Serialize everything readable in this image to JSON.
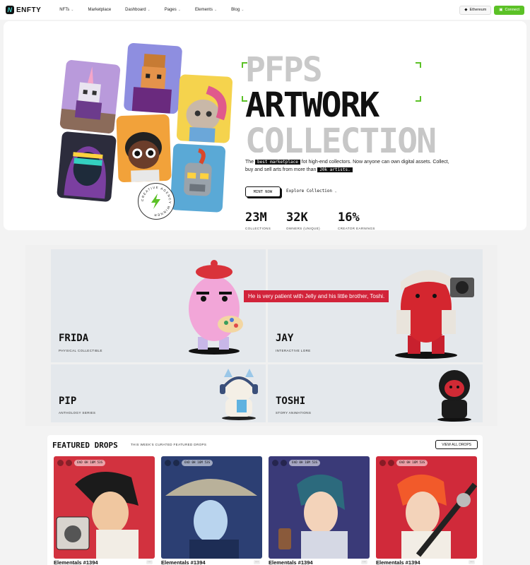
{
  "nav": {
    "brand": "ENFTY",
    "logo_letter": "N",
    "items": [
      {
        "label": "NFTs",
        "has_dropdown": true
      },
      {
        "label": "Marketplace",
        "has_dropdown": false
      },
      {
        "label": "Dashboard",
        "has_dropdown": true
      },
      {
        "label": "Pages",
        "has_dropdown": true
      },
      {
        "label": "Elements",
        "has_dropdown": true
      },
      {
        "label": "Blog",
        "has_dropdown": true
      }
    ],
    "network": "Ethereum",
    "connect": "Connect"
  },
  "hero": {
    "line1": "PFPS",
    "line2": "ARTWORK",
    "line3": "COLLECTION",
    "intro_pre": "The ",
    "intro_tag1": "best marketplace",
    "intro_mid": " fot high-end collectors. Now anyone can own digital assets. Collect, buy and sell arts from more than ",
    "intro_tag2": "20k artists.",
    "mint_label": "MINT NOW",
    "explore_label": "Explore Collection",
    "badge_text": "CREATIVE AGENCY WINNER",
    "stats": [
      {
        "value": "23M",
        "label": "COLLECTIONS"
      },
      {
        "value": "32K",
        "label": "OWNERS (UNIQUE)"
      },
      {
        "value": "16%",
        "label": "CREATOR EARNINGS"
      }
    ]
  },
  "characters": [
    {
      "name": "FRIDA",
      "subtitle": "PHYSICAL COLLECTIBLE"
    },
    {
      "name": "JAY",
      "subtitle": "INTERACTIVE LORE"
    },
    {
      "name": "PIP",
      "subtitle": "ANTHOLOGY SERIES"
    },
    {
      "name": "TOSHI",
      "subtitle": "STORY ANIMATIONS"
    }
  ],
  "tooltip": "He is very patient with Jelly and his little brother, Toshi.",
  "featured": {
    "title": "FEATURED DROPS",
    "subtitle": "THIS WEEK'S CURATED FEATURED DROPS",
    "view_all": "VIEW ALL DROPS",
    "drops": [
      {
        "name": "Elementals #1394",
        "timer": "6hD 0H 10M 53S"
      },
      {
        "name": "Elementals #1394",
        "timer": "6hD 0H 16M 53S"
      },
      {
        "name": "Elementals #1394",
        "timer": "6hD 0H 16M 53S"
      },
      {
        "name": "Elementals #1394",
        "timer": "6hD 0H 16M 53S"
      }
    ]
  },
  "colors": {
    "accent_green": "#5bc126",
    "tooltip_red": "#d2233a",
    "panel": "#e4e8ec"
  }
}
